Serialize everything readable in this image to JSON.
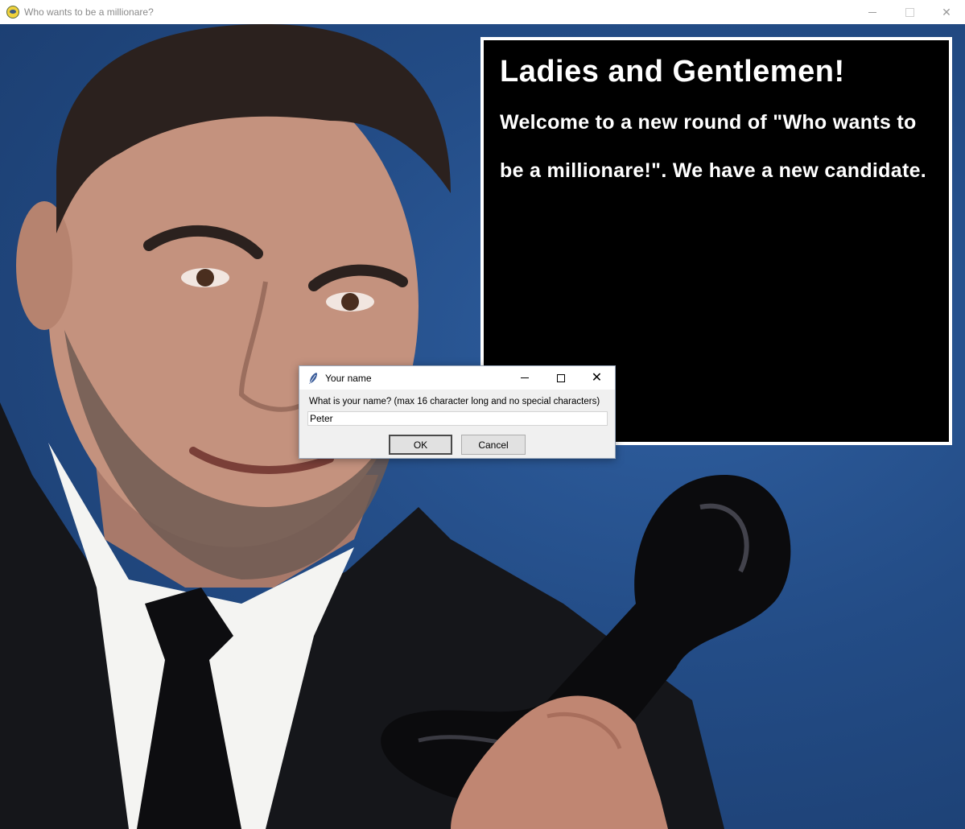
{
  "window": {
    "title": "Who wants to be a millionare?",
    "icon": "pygame-snake-icon",
    "controls": [
      "minimize",
      "maximize",
      "close"
    ]
  },
  "panel": {
    "heading": "Ladies and Gentlemen!",
    "line1": "Welcome to a new round of \"Who wants to",
    "line2": "be a millionare!\". We have a new candidate."
  },
  "dialog": {
    "title": "Your name",
    "icon": "feather-icon",
    "prompt": "What is your name? (max 16 character long and no special characters)",
    "input_value": "Peter",
    "ok_label": "OK",
    "cancel_label": "Cancel",
    "close_glyph": "✕"
  },
  "colors": {
    "background_blue": "#234c86",
    "panel_bg": "#000000",
    "panel_text": "#ffffff",
    "dialog_bg": "#f0f0f0"
  }
}
